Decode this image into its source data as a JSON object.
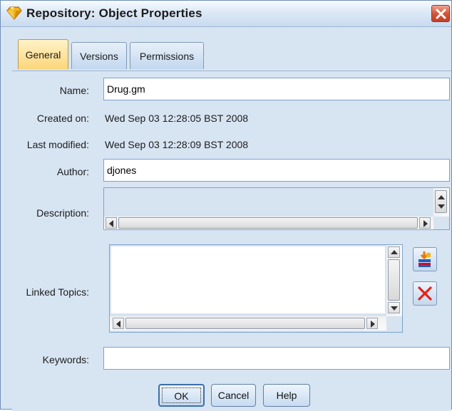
{
  "window": {
    "title": "Repository: Object Properties",
    "accent": "#fcd67a",
    "background": "#d7e4f2"
  },
  "tabs": [
    {
      "label": "General",
      "selected": true
    },
    {
      "label": "Versions",
      "selected": false
    },
    {
      "label": "Permissions",
      "selected": false
    }
  ],
  "fields": {
    "name_label": "Name:",
    "name_value": "Drug.gm",
    "created_label": "Created on:",
    "created_value": "Wed Sep 03 12:28:05 BST 2008",
    "modified_label": "Last modified:",
    "modified_value": "Wed Sep 03 12:28:09 BST 2008",
    "author_label": "Author:",
    "author_value": "djones",
    "description_label": "Description:",
    "description_value": "",
    "linked_topics_label": "Linked Topics:",
    "keywords_label": "Keywords:",
    "keywords_value": ""
  },
  "side_buttons": [
    {
      "icon": "add-topic-icon"
    },
    {
      "icon": "delete-icon"
    }
  ],
  "buttons": {
    "ok": "OK",
    "cancel": "Cancel",
    "help": "Help"
  }
}
